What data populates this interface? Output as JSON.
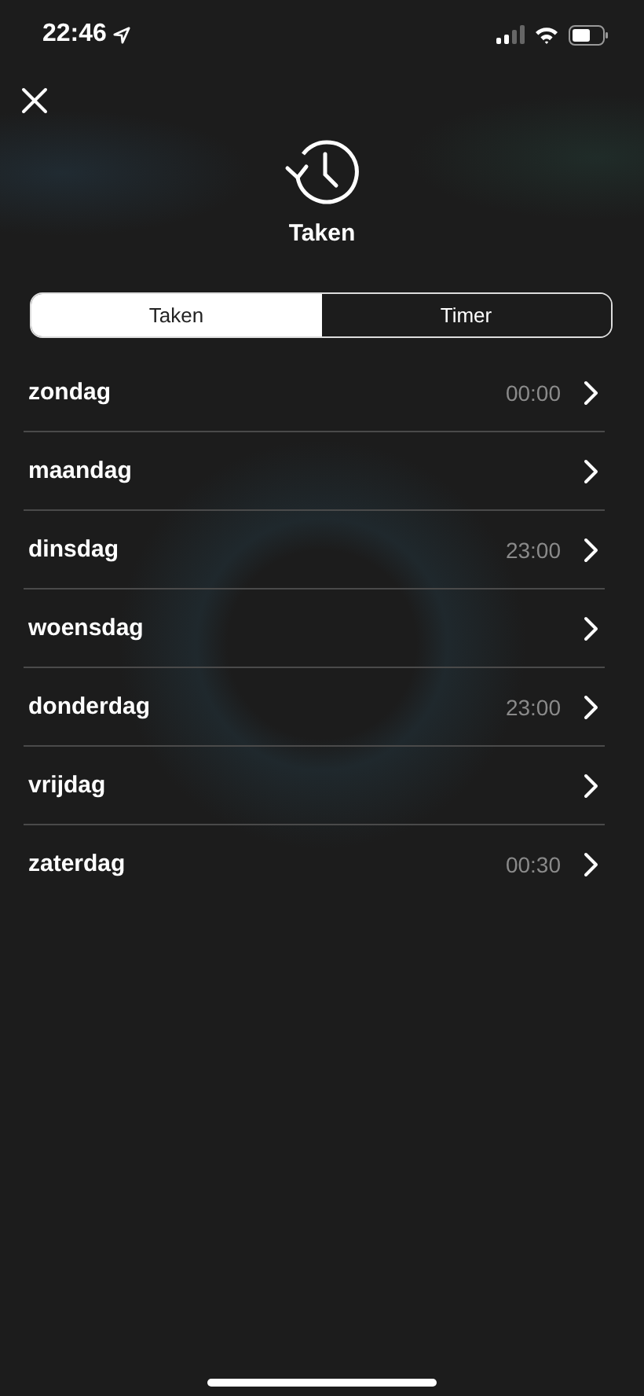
{
  "status_bar": {
    "time": "22:46"
  },
  "header": {
    "title": "Taken"
  },
  "tabs": [
    {
      "label": "Taken",
      "selected": true
    },
    {
      "label": "Timer",
      "selected": false
    }
  ],
  "days": [
    {
      "name": "zondag",
      "time": "00:00"
    },
    {
      "name": "maandag"
    },
    {
      "name": "dinsdag",
      "time": "23:00"
    },
    {
      "name": "woensdag"
    },
    {
      "name": "donderdag",
      "time": "23:00"
    },
    {
      "name": "vrijdag"
    },
    {
      "name": "zaterdag",
      "time": "00:30"
    }
  ]
}
